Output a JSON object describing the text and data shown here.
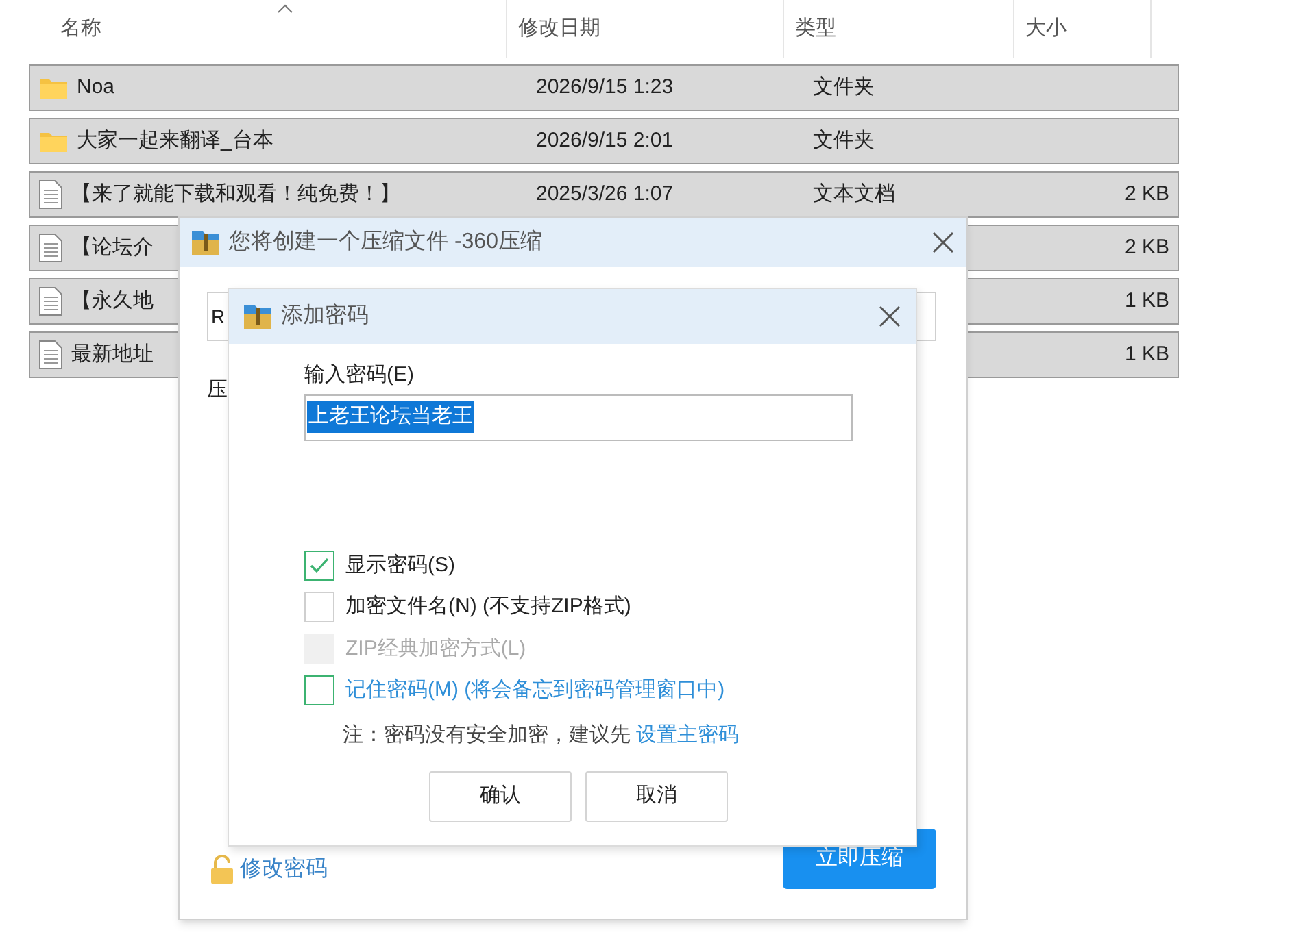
{
  "file_list": {
    "columns": [
      "名称",
      "修改日期",
      "类型",
      "大小"
    ],
    "rows": [
      {
        "kind": "folder",
        "name": "Noa",
        "date": "2026/9/15 1:23",
        "type": "文件夹",
        "selected": true
      },
      {
        "kind": "folder",
        "name": "大家一起来翻译_台本",
        "date": "2026/9/15 2:01",
        "type": "文件夹",
        "selected": true
      },
      {
        "kind": "text",
        "name": "【来了就能下载和观看！纯免费！】",
        "date": "2025/3/26 1:07",
        "type": "文本文档",
        "size": "2 KB",
        "selected": true
      },
      {
        "kind": "text",
        "name": "【论坛介",
        "size": "2 KB",
        "selected": true
      },
      {
        "kind": "text",
        "name": "【永久地",
        "size": "1 KB",
        "selected": true
      },
      {
        "kind": "text",
        "name": "最新地址",
        "size": "1 KB",
        "selected": true
      }
    ]
  },
  "compress_dialog": {
    "title": "您将创建一个压缩文件 -360压缩",
    "path_value": "R",
    "label": "压",
    "change_password_link": "修改密码",
    "compress_button": "立即压缩"
  },
  "password_dialog": {
    "title": "添加密码",
    "password_label": "输入密码(E)",
    "password_value": "上老王论坛当老王",
    "options": [
      {
        "kind": "plain",
        "label": "显示密码(S)",
        "checked": true,
        "disabled": false
      },
      {
        "kind": "plain",
        "label": "加密文件名(N) (不支持ZIP格式)",
        "checked": false,
        "disabled": false
      },
      {
        "kind": "plain",
        "label": "ZIP经典加密方式(L)",
        "checked": false,
        "disabled": true
      },
      {
        "kind": "link",
        "label": "记住密码(M) (将会备忘到密码管理窗口中)",
        "checked": false,
        "disabled": false
      }
    ],
    "note": "注：密码没有安全加密，建议先",
    "note_link": "设置主密码",
    "buttons": [
      "确认",
      "取消"
    ]
  }
}
